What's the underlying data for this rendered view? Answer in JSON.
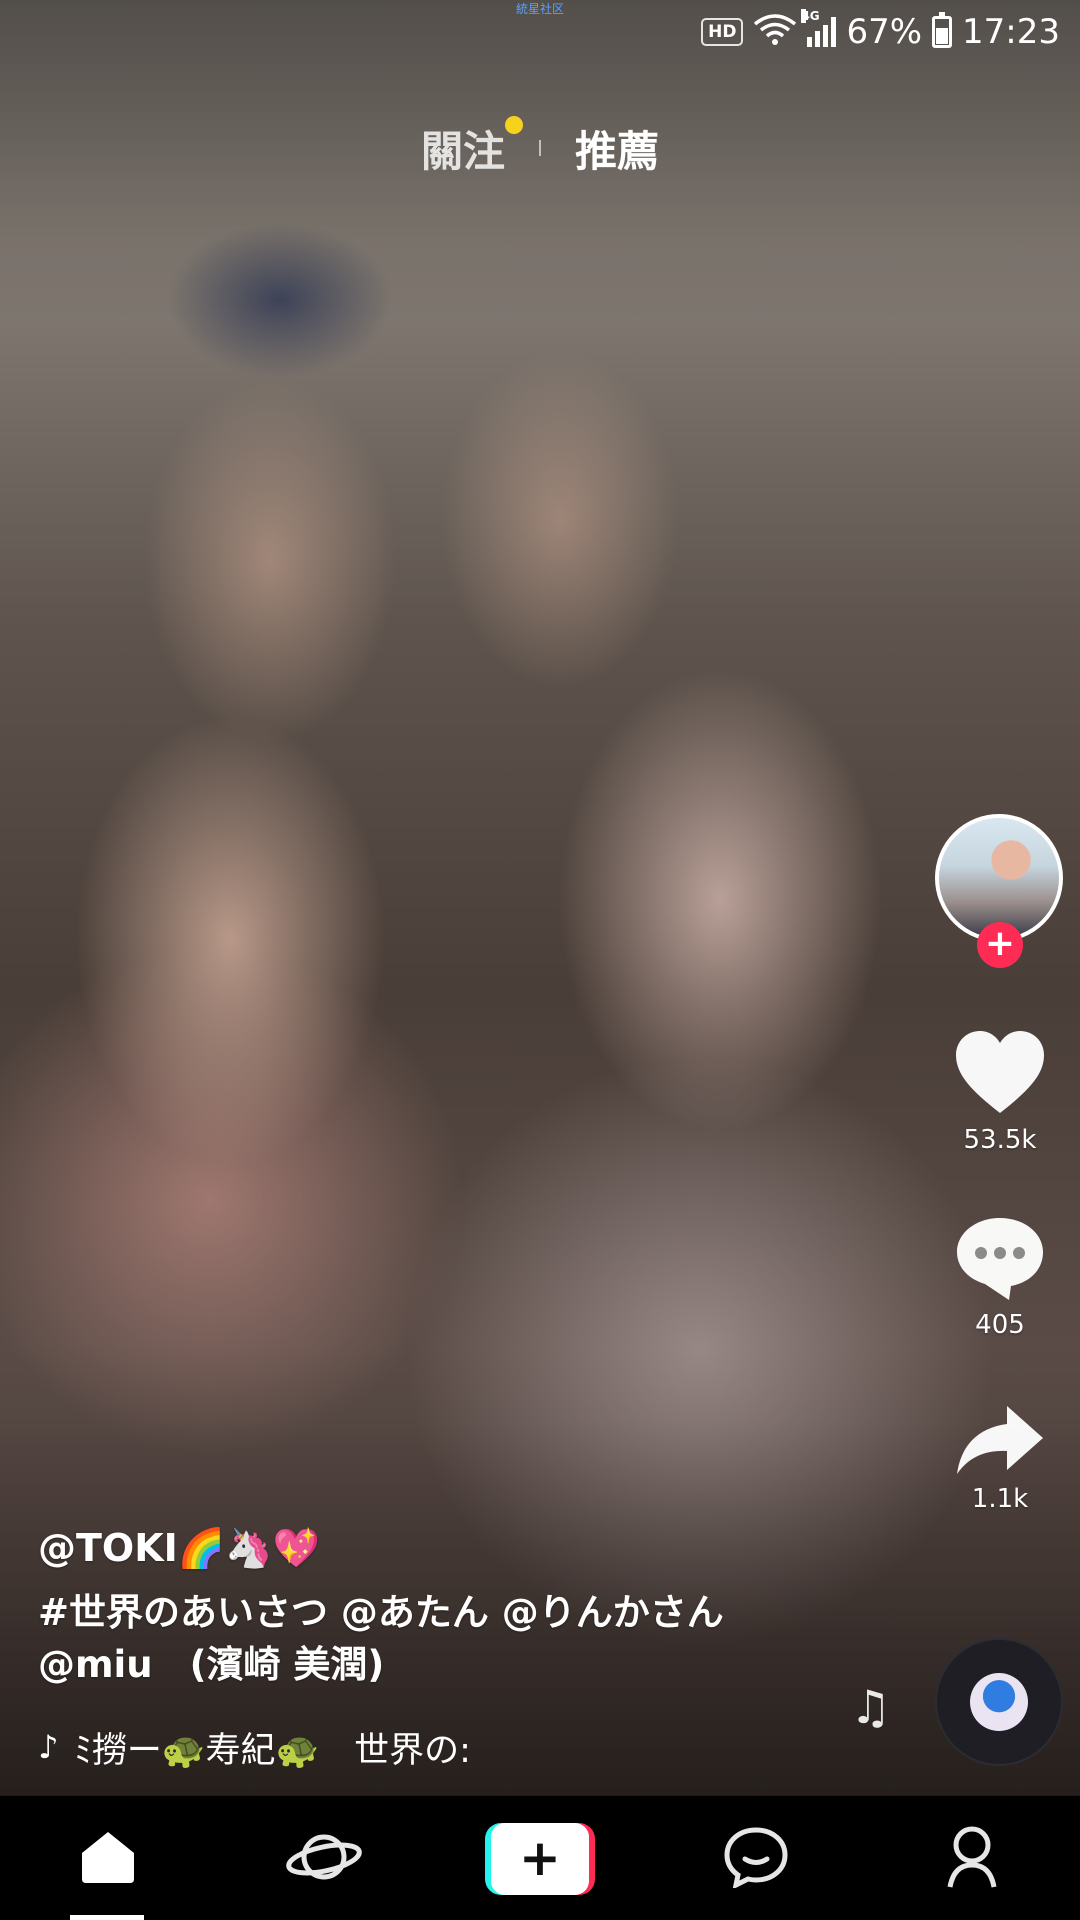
{
  "status_bar": {
    "carrier_label": "統星社区",
    "hd_label": "HD",
    "network_label": "4G",
    "battery_percent": "67%",
    "time": "17:23"
  },
  "top_tabs": {
    "following": "關注",
    "for_you": "推薦",
    "following_has_new": true
  },
  "actions": {
    "likes": "53.5k",
    "comments": "405",
    "shares": "1.1k"
  },
  "caption": {
    "username": "@TOKI🌈🦄💖",
    "description_line1": "#世界のあいさつ @あたん @りんかさん",
    "description_line2": "@miu　(濱崎  美潤)"
  },
  "music": {
    "scrolling_text": "ﾐ撈ー🐢寿紀🐢　世界の:"
  },
  "colors": {
    "accent_red": "#fe2c55",
    "accent_cyan": "#25f4ee",
    "notification_dot": "#f7d21d",
    "nav_background": "#000000"
  },
  "icons": {
    "nav": [
      "home-icon",
      "discover-planet-icon",
      "create-plus-icon",
      "inbox-chat-icon",
      "profile-icon"
    ],
    "actions": [
      "heart-icon",
      "comment-icon",
      "share-arrow-icon"
    ]
  },
  "bottom_nav": {
    "active": "home",
    "create_symbol": "+"
  }
}
